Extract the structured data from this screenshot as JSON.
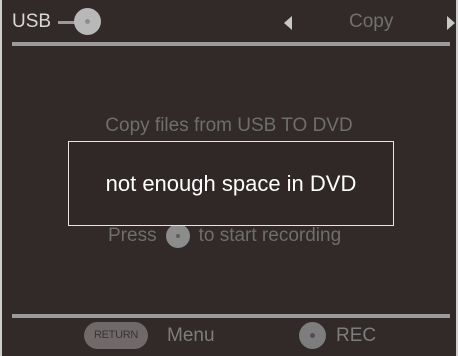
{
  "header": {
    "source_label": "USB",
    "source_icon": "disc-icon",
    "mode_label": "Copy"
  },
  "body": {
    "instruction": "Copy files from USB TO DVD",
    "press_text": "Press",
    "record_hint": "to start recording"
  },
  "dialog": {
    "message": "not enough space in DVD"
  },
  "footer": {
    "return_label": "RETURN",
    "menu_label": "Menu",
    "rec_label": "REC"
  },
  "colors": {
    "background": "#312a28",
    "dialog_border": "#e6e6e6",
    "divider": "#9b9b9b"
  }
}
